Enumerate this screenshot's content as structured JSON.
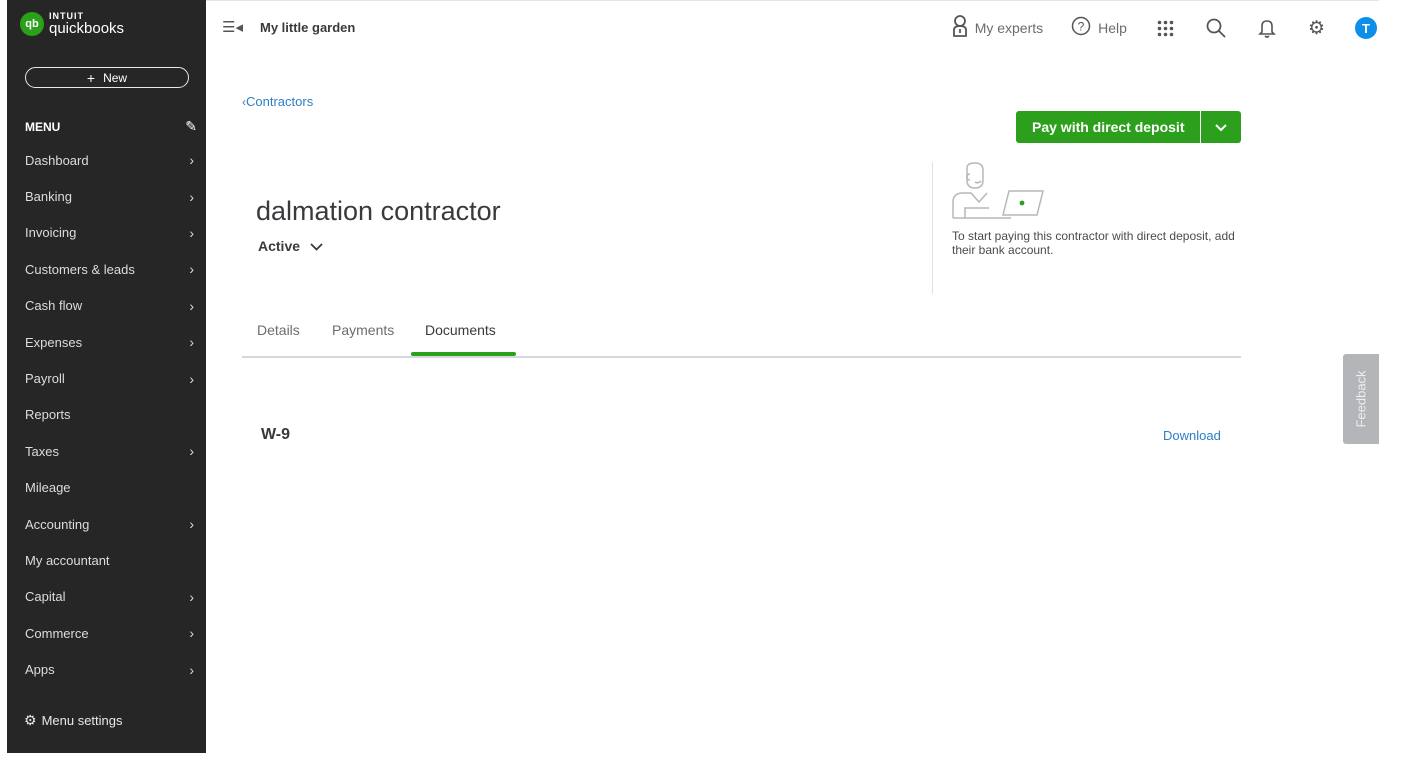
{
  "brand": {
    "mark": "qb",
    "line1": "INTUIT",
    "line2": "quickbooks",
    "accent": "#2ca01c"
  },
  "sidebar": {
    "new_label": "New",
    "menu_label": "MENU",
    "items": [
      {
        "label": "Dashboard",
        "has_chevron": true
      },
      {
        "label": "Banking",
        "has_chevron": true
      },
      {
        "label": "Invoicing",
        "has_chevron": true
      },
      {
        "label": "Customers & leads",
        "has_chevron": true
      },
      {
        "label": "Cash flow",
        "has_chevron": true
      },
      {
        "label": "Expenses",
        "has_chevron": true
      },
      {
        "label": "Payroll",
        "has_chevron": true
      },
      {
        "label": "Reports",
        "has_chevron": false
      },
      {
        "label": "Taxes",
        "has_chevron": true
      },
      {
        "label": "Mileage",
        "has_chevron": false
      },
      {
        "label": "Accounting",
        "has_chevron": true
      },
      {
        "label": "My accountant",
        "has_chevron": false
      },
      {
        "label": "Capital",
        "has_chevron": true
      },
      {
        "label": "Commerce",
        "has_chevron": true
      },
      {
        "label": "Apps",
        "has_chevron": true
      }
    ],
    "settings_label": "Menu settings"
  },
  "topbar": {
    "company": "My little garden",
    "experts_label": "My experts",
    "help_label": "Help",
    "avatar_initial": "T"
  },
  "page": {
    "back_label": "Contractors",
    "title": "dalmation contractor",
    "status": "Active",
    "pay_button": "Pay with direct deposit",
    "direct_deposit_text": "To start paying this contractor with direct deposit, add their bank account.",
    "tabs": [
      {
        "label": "Details",
        "active": false
      },
      {
        "label": "Payments",
        "active": false
      },
      {
        "label": "Documents",
        "active": true
      }
    ],
    "documents": [
      {
        "name": "W-9",
        "action": "Download"
      }
    ]
  },
  "feedback_label": "Feedback"
}
